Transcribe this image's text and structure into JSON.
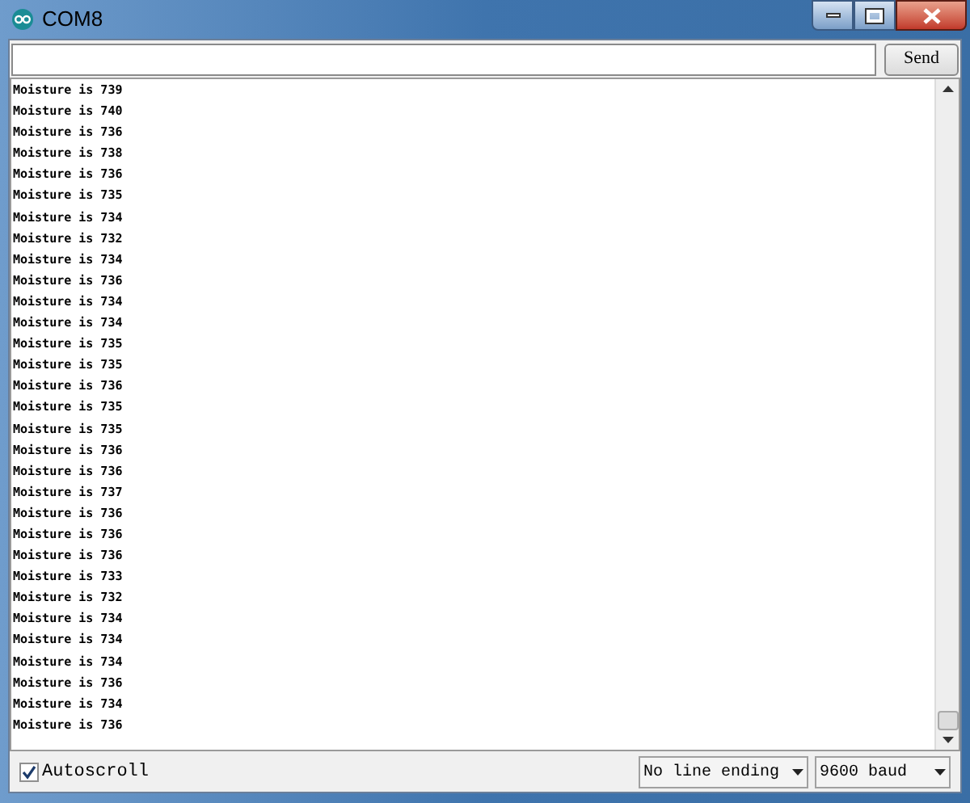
{
  "window": {
    "title": "COM8"
  },
  "send_button": {
    "label": "Send"
  },
  "output_lines": [
    "Moisture is 739",
    "Moisture is 740",
    "Moisture is 736",
    "Moisture is 738",
    "Moisture is 736",
    "Moisture is 735",
    "Moisture is 734",
    "Moisture is 732",
    "Moisture is 734",
    "Moisture is 736",
    "Moisture is 734",
    "Moisture is 734",
    "Moisture is 735",
    "Moisture is 735",
    "Moisture is 736",
    "Moisture is 735",
    "Moisture is 735",
    "Moisture is 736",
    "Moisture is 736",
    "Moisture is 737",
    "Moisture is 736",
    "Moisture is 736",
    "Moisture is 736",
    "Moisture is 733",
    "Moisture is 732",
    "Moisture is 734",
    "Moisture is 734",
    "Moisture is 734",
    "Moisture is 736",
    "Moisture is 734",
    "Moisture is 736"
  ],
  "autoscroll": {
    "label": "Autoscroll",
    "checked": true
  },
  "line_ending": {
    "value": "No line ending"
  },
  "baud_rate": {
    "value": "9600 baud"
  }
}
